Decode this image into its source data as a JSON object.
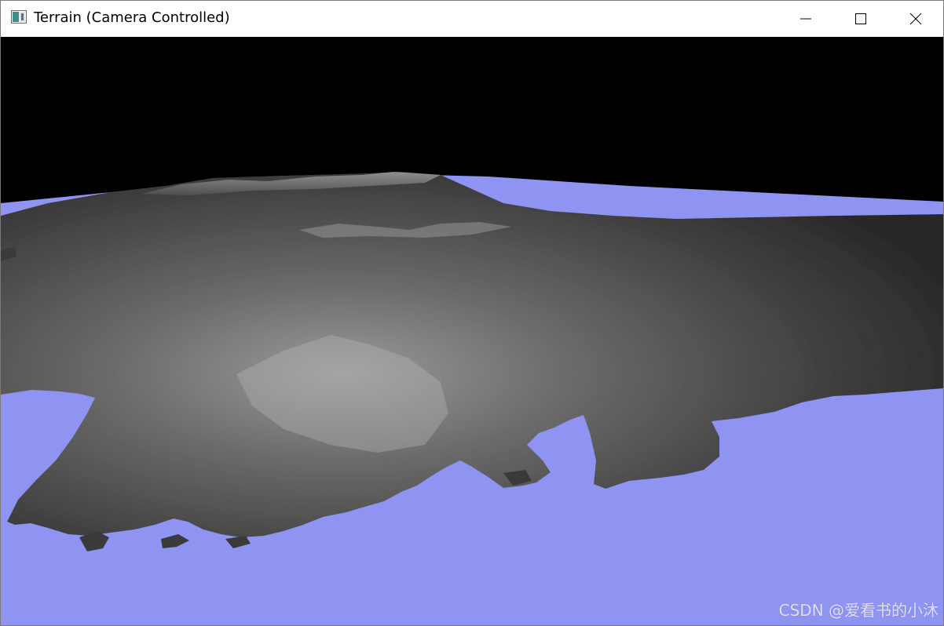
{
  "window": {
    "title": "Terrain (Camera Controlled)",
    "icon": "app-window-icon",
    "controls": {
      "minimize_icon": "minimize-icon",
      "maximize_icon": "maximize-icon",
      "close_icon": "close-icon"
    }
  },
  "scene": {
    "sky_color": "#000000",
    "water_color": "#8f93f2",
    "terrain_color_low": "#2e2e2e",
    "terrain_color_high": "#a8a8a8"
  },
  "watermark": {
    "text": "CSDN @爱看书的小沐"
  }
}
